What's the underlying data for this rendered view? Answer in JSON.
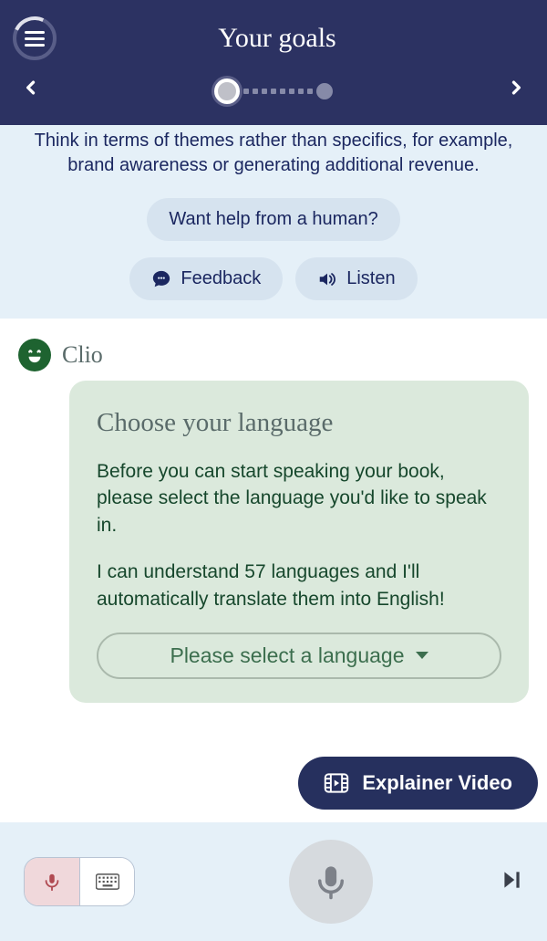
{
  "header": {
    "title": "Your goals"
  },
  "instructions": {
    "text": "Think in terms of themes rather than specifics, for example, brand awareness or generating additional revenue.",
    "help_label": "Want help from a human?",
    "feedback_label": "Feedback",
    "listen_label": "Listen"
  },
  "chat": {
    "sender_name": "Clio",
    "card_title": "Choose your language",
    "card_p1": "Before you can start speaking your book, please select the language you'd like to speak in.",
    "card_p2": "I can understand 57 languages and I'll automatically translate them into English!",
    "select_placeholder": "Please select a language"
  },
  "explainer": {
    "label": "Explainer Video"
  }
}
